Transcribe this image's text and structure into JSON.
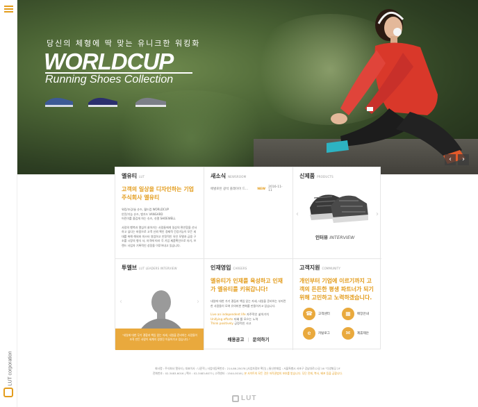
{
  "hero": {
    "tagline": "당신의 체형에 딱 맞는 유니크한 워킹화",
    "title": "WORLDCUP",
    "subtitle": "Running Shoes  Collection",
    "prev_label": "‹",
    "next_label": "›"
  },
  "rail": {
    "logo_text": "LUT corporation"
  },
  "about": {
    "title": "엘유티",
    "title_en": "LUT",
    "headline": "고객의 일상을 디자인하는 기업 주식회사 엘유티",
    "brands": [
      "워킹/조깅/슬 슈즈, 월드컵 WORLDCUP",
      "안전/기능 슈즈, 뱅가드 VANGARD",
      "어린이를 즐겁게 하는 슈즈, 슈엘 SHOEWELL"
    ],
    "body": "사람의 행복과 열심히 살아가는 사람들에게 일상의 편안함을 선사하고 싶다는 바람으로 고객 신뢰 확인 경제적 건강기능이 모든 세대를 위해 해외와 미스터 영업하고 안정적인 유인 모델과 금융 구조를 시장의 형식 사, 자격에 따라 각 기업 제품확인으로 자기, 브랜드 사업자 기록적인 성장을 이루어내고 있습니다."
  },
  "news": {
    "title": "새소식",
    "title_en": "NEWSROOM",
    "items": [
      {
        "title": "에벌로된 광석 플레이어 드...",
        "badge": "NEW",
        "date": "2016-11-11"
      }
    ]
  },
  "product": {
    "title": "신제품",
    "title_en": "PRODUCTS",
    "caption_ko": "인터뷰",
    "caption_en": "INTERVIEW"
  },
  "people": {
    "title": "투엘브",
    "title_en": "LUT LEADERS INTERVIEW",
    "quote": "\"내일에 대한 무기 결합과 책임 있는 자세, 내일을 준비하는 사람들이 조직 만든 사람이 세계의 경영진 이끌어가고 있습니다.\""
  },
  "careers": {
    "title": "인재영입",
    "title_en": "CAREERS",
    "headline": "엘유티가 인재를 육성하고 인재가 엘유티를 키워갑니다!",
    "body": "내일에 대한 가기 결집과 책임 있는 자세, 내일을 준비하는 부지런한 사람들이 모여 유의미한 변화를 만들어가고 있습니다.",
    "bullets": [
      {
        "en": "Live an independent life",
        "ko": "자주적인 삶의가치"
      },
      {
        "en": "Unifying efforts",
        "ko": "지혜 를 모으는 노력"
      },
      {
        "en": "Think positively",
        "ko": "긍정적인 사고"
      }
    ],
    "link_hire": "채용공고",
    "link_inquiry": "문의하기"
  },
  "support": {
    "title": "고객지원",
    "title_en": "COMMUNITY",
    "headline": "개인부터 기업에 이르기까지 고객의 든든한 평생 파트너가 되기 위해 고민하고 노력하겠습니다.",
    "services": [
      {
        "label": "고객센터",
        "icon": "headset-icon"
      },
      {
        "label": "매장안내",
        "icon": "store-icon"
      },
      {
        "label": "카탈로그",
        "icon": "catalog-icon"
      },
      {
        "label": "제휴제안",
        "icon": "envelope-icon"
      }
    ]
  },
  "footer": {
    "line1": "회사명 : 주식회사 엘유티  |  대표이사 : 나준혁  |  사업자등록번호 : 214-86-25078  [사업자정보 확인]  |  통신판매업 : 서울특별시 서초구 강남대로12길 16 “다양빌딩 2F",
    "line2_a": "전화번호 : 02-3483-6016  |  팩스 : 02-3483-6073  |  고객센터 : 1544-0016  |  ",
    "line2_b": "본 사이트의 모든 것은 저작권법의 보호를 받습니다. 무단 전재, 복사, 배포 등을 금합니다.",
    "logo": "LUT"
  },
  "colors": {
    "accent": "#e39c1c",
    "accent_light": "#e9a93d"
  }
}
